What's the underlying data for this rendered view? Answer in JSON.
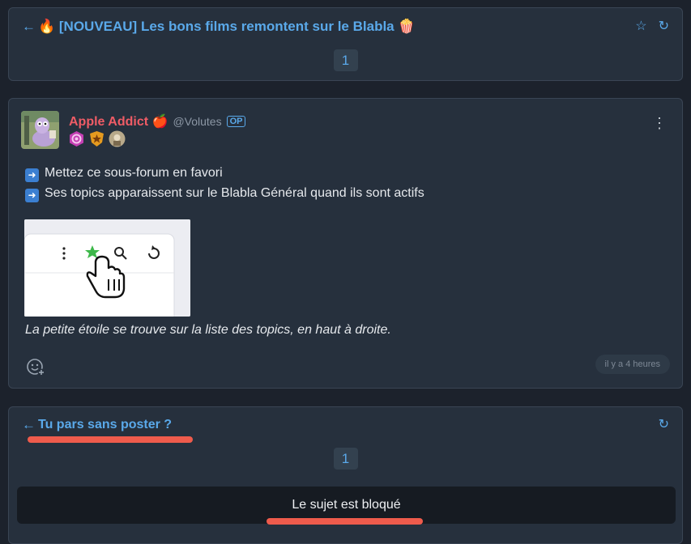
{
  "topic": {
    "title": "🔥 [NOUVEAU] Les bons films remontent sur le Blabla 🍿",
    "back_icon": "arrow-left-icon",
    "star_icon": "star-outline-icon",
    "refresh_icon": "refresh-icon",
    "page": "1"
  },
  "post": {
    "author_name": "Apple Addict 🍎",
    "author_handle": "@Volutes",
    "op_badge": "OP",
    "lines": [
      "Mettez ce sous-forum en favori",
      "Ses topics apparaissent sur le Blabla Général quand ils sont actifs"
    ],
    "caption": "La petite étoile se trouve sur la liste des topics, en haut à droite.",
    "timestamp": "il y a 4 heures"
  },
  "related": {
    "title": "Tu pars sans poster ?",
    "page": "1",
    "locked_text": "Le sujet est bloqué"
  },
  "colors": {
    "accent": "#5aa9ea",
    "author": "#f05c66",
    "highlight": "#ee5b4c"
  }
}
